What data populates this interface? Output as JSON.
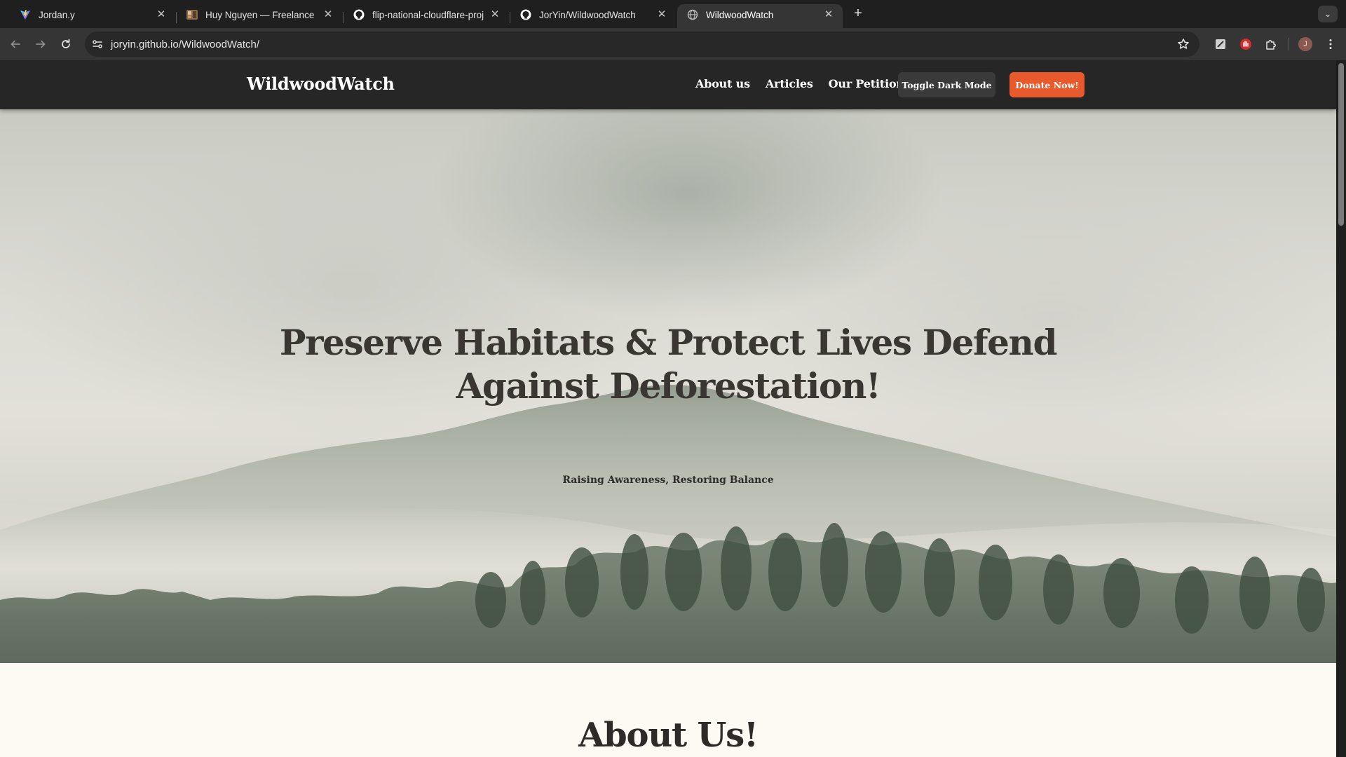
{
  "browser": {
    "tabs": [
      {
        "title": "Jordan.y",
        "icon": "vite-logo-icon",
        "active": false
      },
      {
        "title": "Huy Nguyen — Freelance Wel",
        "icon": "site-thumbnail-icon",
        "active": false
      },
      {
        "title": "flip-national-cloudflare-proje",
        "icon": "github-icon",
        "active": false
      },
      {
        "title": "JorYin/WildwoodWatch",
        "icon": "github-icon",
        "active": false
      },
      {
        "title": "WildwoodWatch",
        "icon": "globe-icon",
        "active": true
      }
    ],
    "address": "joryin.github.io/WildwoodWatch/",
    "profile_initial": "J"
  },
  "site": {
    "brand": "WildwoodWatch",
    "nav": {
      "about": "About us",
      "articles": "Articles",
      "petition": "Our Petition!"
    },
    "toggle_label": "Toggle Dark Mode",
    "donate_label": "Donate Now!"
  },
  "hero": {
    "title": "Preserve Habitats & Protect Lives Defend Against Deforestation!",
    "subtitle": "Raising Awareness, Restoring Balance"
  },
  "about": {
    "heading": "About Us!"
  },
  "colors": {
    "nav_bg": "#262626",
    "donate": "#e8592c",
    "toggle_bg": "#3a3a3a",
    "page_bg": "#fdfaf3"
  }
}
